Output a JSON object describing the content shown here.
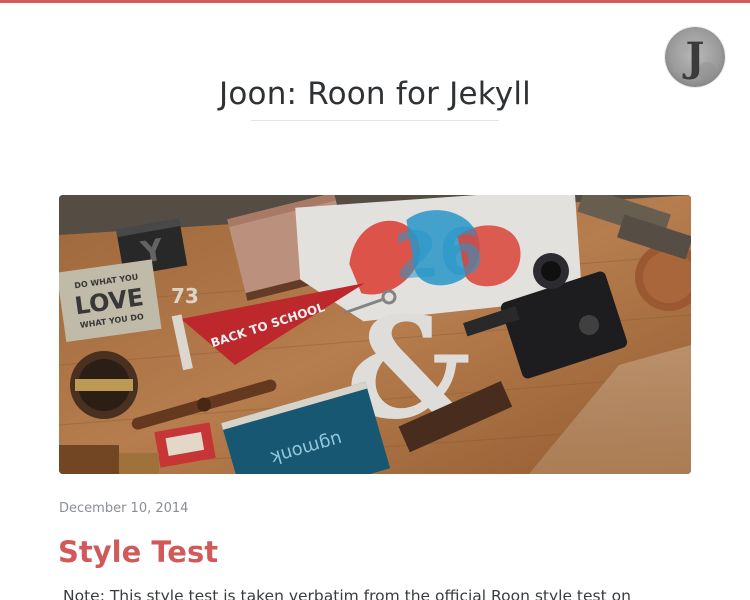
{
  "site": {
    "title": "Joon: Roon for Jekyll",
    "avatar_letter": "J",
    "accent_color": "#d45a5a"
  },
  "post": {
    "date": "December 10, 2014",
    "title": "Style Test",
    "excerpt": "Note: This style test is taken verbatim from the official Roon style test on"
  },
  "hero_image": {
    "letters_block": "Y",
    "number_block": "73",
    "card_top": "DO WHAT YOU",
    "card_main": "LOVE",
    "card_bottom": "WHAT YOU DO",
    "pennant_text": "BACK TO SCHOOL",
    "shirt_text": "26",
    "book_text": "ugmonk"
  }
}
